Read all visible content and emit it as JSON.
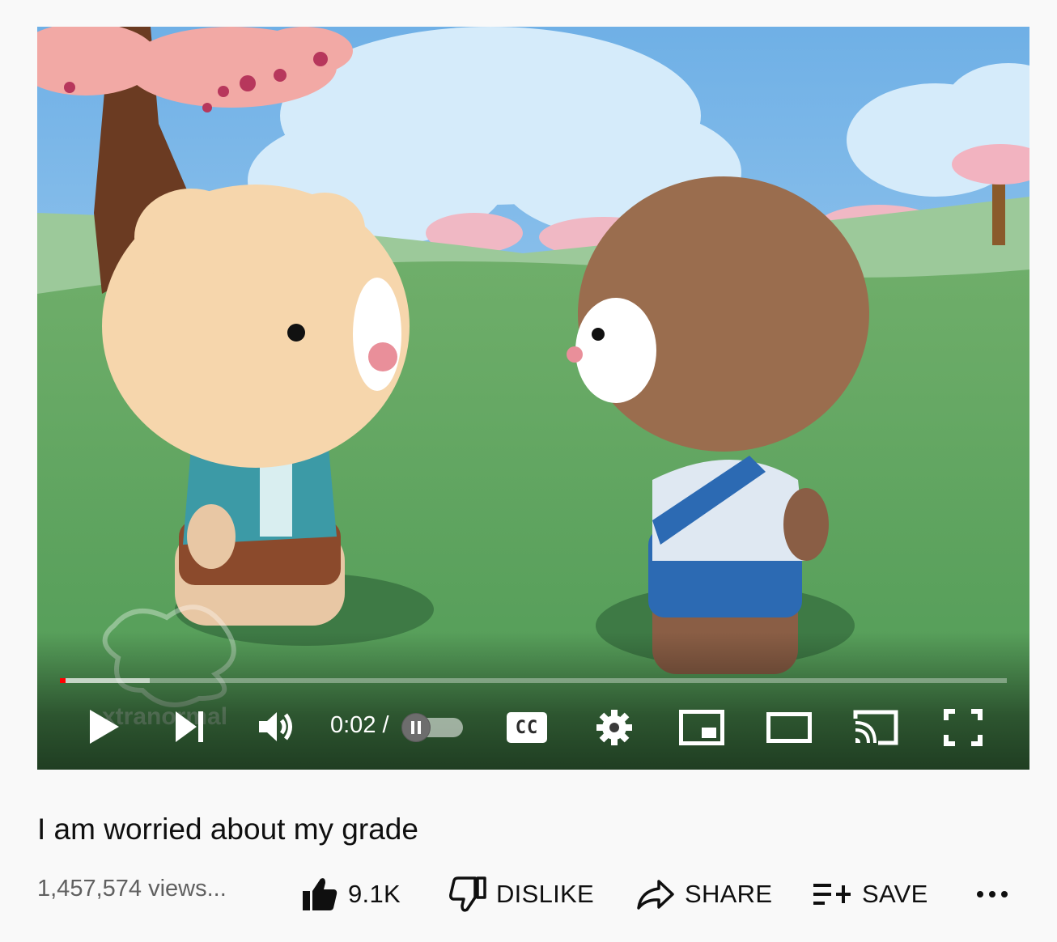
{
  "player": {
    "time_current": "0:02 /",
    "progress_played_fraction": 0.006,
    "progress_buffered_fraction": 0.095,
    "autoplay_on": false,
    "watermark": "xtranormal",
    "controls": {
      "play": "play-icon",
      "next": "next-icon",
      "volume": "volume-icon",
      "autoplay": "pause-icon",
      "captions": "CC",
      "settings": "gear-icon",
      "miniplayer": "miniplayer-icon",
      "theater": "theater-mode-icon",
      "cast": "cast-icon",
      "fullscreen": "fullscreen-icon"
    }
  },
  "video": {
    "title": "I am worried about my grade",
    "views": "1,457,574 views..."
  },
  "actions": {
    "like_count": "9.1K",
    "dislike_label": "DISLIKE",
    "share_label": "SHARE",
    "save_label": "SAVE",
    "more": "..."
  },
  "colors": {
    "progress_red": "#ff0000",
    "text_primary": "#0f0f0f",
    "text_secondary": "#606060",
    "background": "#f9f9f9"
  }
}
